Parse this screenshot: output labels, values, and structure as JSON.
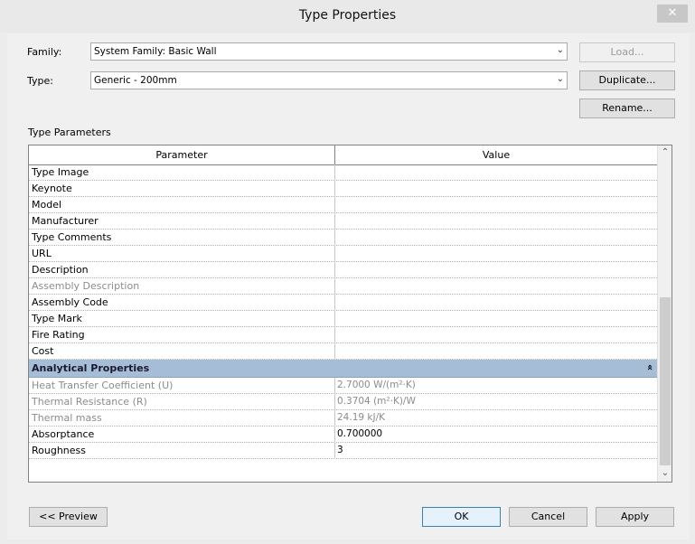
{
  "window": {
    "title": "Type Properties",
    "close_glyph": "✕"
  },
  "family": {
    "label": "Family:",
    "value": "System Family: Basic Wall"
  },
  "type": {
    "label": "Type:",
    "value": "Generic - 200mm"
  },
  "buttons": {
    "load": "Load...",
    "duplicate": "Duplicate...",
    "rename": "Rename...",
    "preview": "<< Preview",
    "ok": "OK",
    "cancel": "Cancel",
    "apply": "Apply"
  },
  "type_parameters": {
    "heading": "Type Parameters",
    "columns": {
      "parameter": "Parameter",
      "value": "Value"
    },
    "rows_top": [
      {
        "parameter": "Type Image",
        "value": ""
      },
      {
        "parameter": "Keynote",
        "value": ""
      },
      {
        "parameter": "Model",
        "value": ""
      },
      {
        "parameter": "Manufacturer",
        "value": ""
      },
      {
        "parameter": "Type Comments",
        "value": ""
      },
      {
        "parameter": "URL",
        "value": ""
      },
      {
        "parameter": "Description",
        "value": ""
      },
      {
        "parameter": "Assembly Description",
        "value": "",
        "disabled": true
      },
      {
        "parameter": "Assembly Code",
        "value": ""
      },
      {
        "parameter": "Type Mark",
        "value": ""
      },
      {
        "parameter": "Fire Rating",
        "value": ""
      },
      {
        "parameter": "Cost",
        "value": ""
      }
    ],
    "group": {
      "title": "Analytical Properties",
      "collapse_glyph": "«"
    },
    "rows_group": [
      {
        "parameter": "Heat Transfer Coefficient (U)",
        "value": "2.7000 W/(m²·K)",
        "disabled": true
      },
      {
        "parameter": "Thermal Resistance (R)",
        "value": "0.3704 (m²·K)/W",
        "disabled": true
      },
      {
        "parameter": "Thermal mass",
        "value": "24.19 kJ/K",
        "disabled": true
      },
      {
        "parameter": "Absorptance",
        "value": "0.700000"
      },
      {
        "parameter": "Roughness",
        "value": "3"
      }
    ]
  },
  "icons": {
    "dropdown": "chevron-down-icon",
    "scroll_up": "arrow-up-icon",
    "scroll_down": "arrow-down-icon",
    "collapse": "collapse-group-icon",
    "close": "close-icon"
  }
}
